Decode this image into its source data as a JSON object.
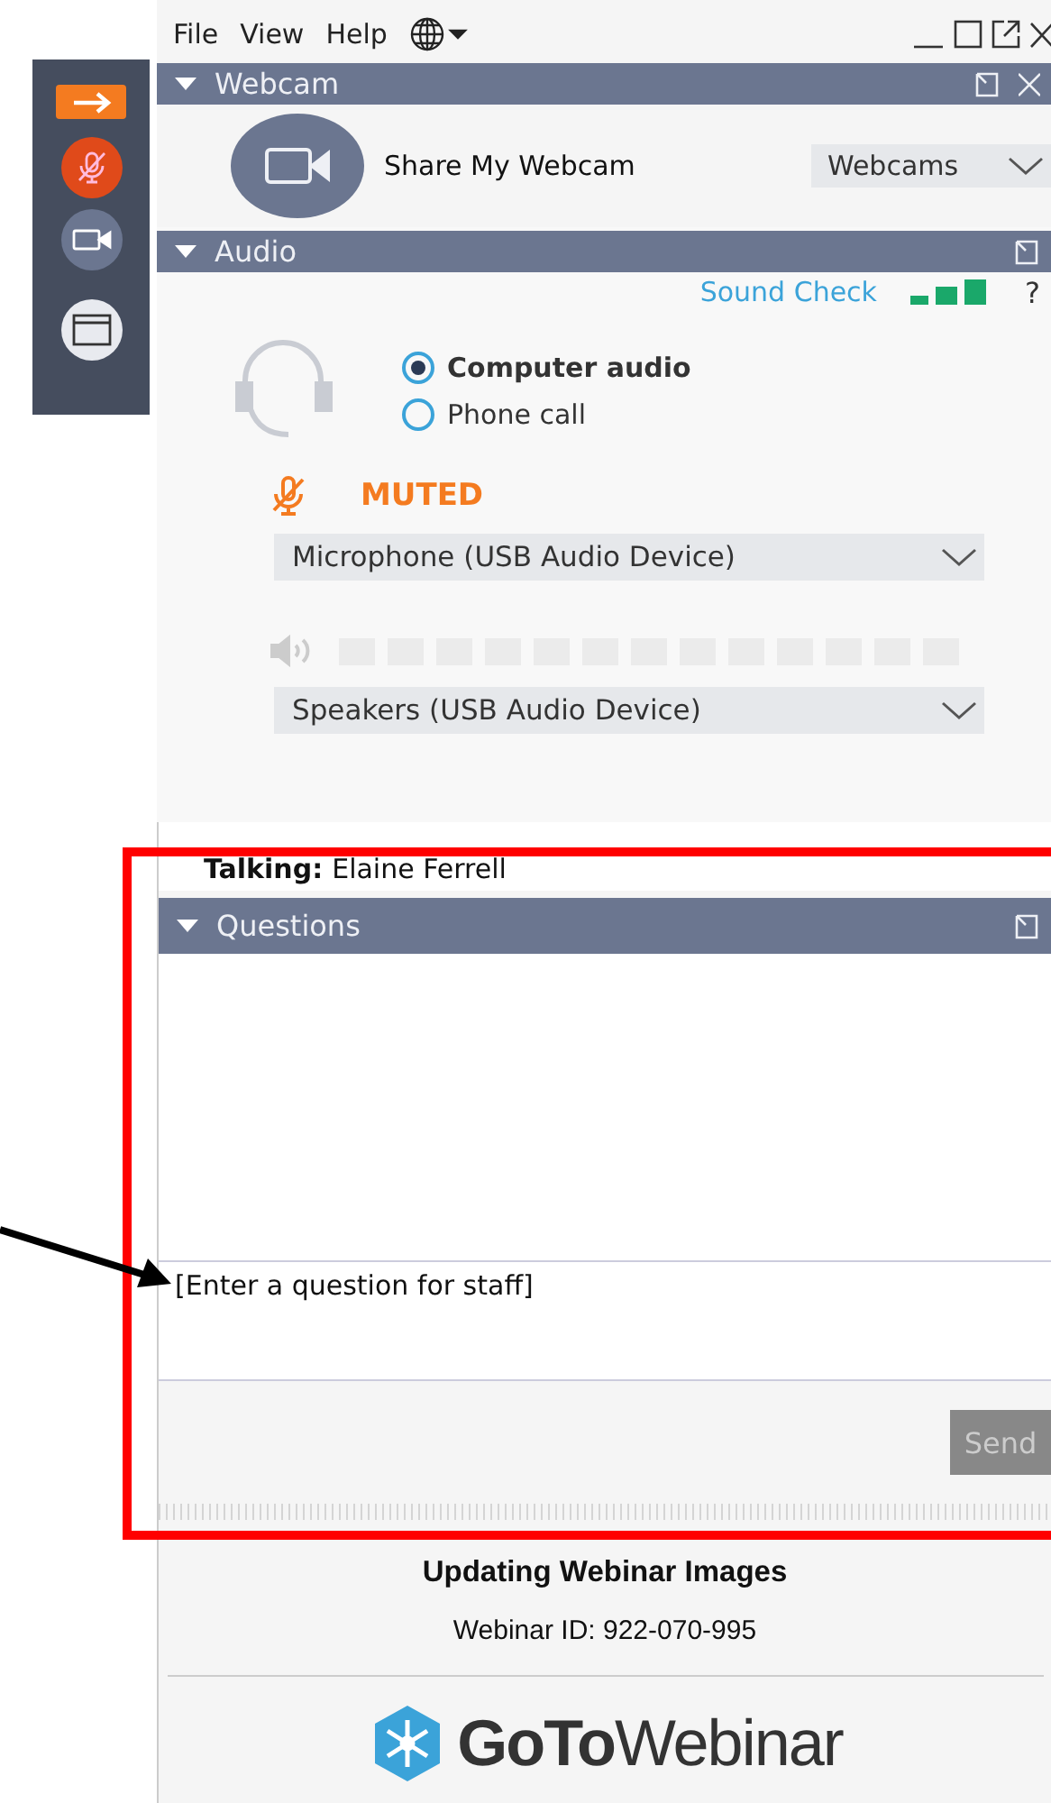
{
  "menu": [
    "File",
    "View",
    "Help"
  ],
  "toolbar": {
    "mic_muted": true
  },
  "webcam": {
    "title": "Webcam",
    "share_label": "Share My Webcam",
    "dropdown": "Webcams"
  },
  "audio": {
    "title": "Audio",
    "sound_check": "Sound Check",
    "help": "?",
    "options": [
      {
        "label": "Computer audio",
        "selected": true
      },
      {
        "label": "Phone call",
        "selected": false
      }
    ],
    "muted": true,
    "status": "MUTED",
    "microphone": "Microphone (USB Audio Device)",
    "speakers": "Speakers (USB Audio Device)"
  },
  "talking": {
    "label": "Talking:",
    "name": "Elaine Ferrell"
  },
  "questions": {
    "title": "Questions",
    "placeholder": "[Enter a question for staff]",
    "send": {
      "label": "Send",
      "disabled": true
    }
  },
  "footer": {
    "title": "Updating Webinar Images",
    "webinar_id": "Webinar ID: 922-070-995",
    "logo_bold": "GoTo",
    "logo_light": "Webinar"
  }
}
